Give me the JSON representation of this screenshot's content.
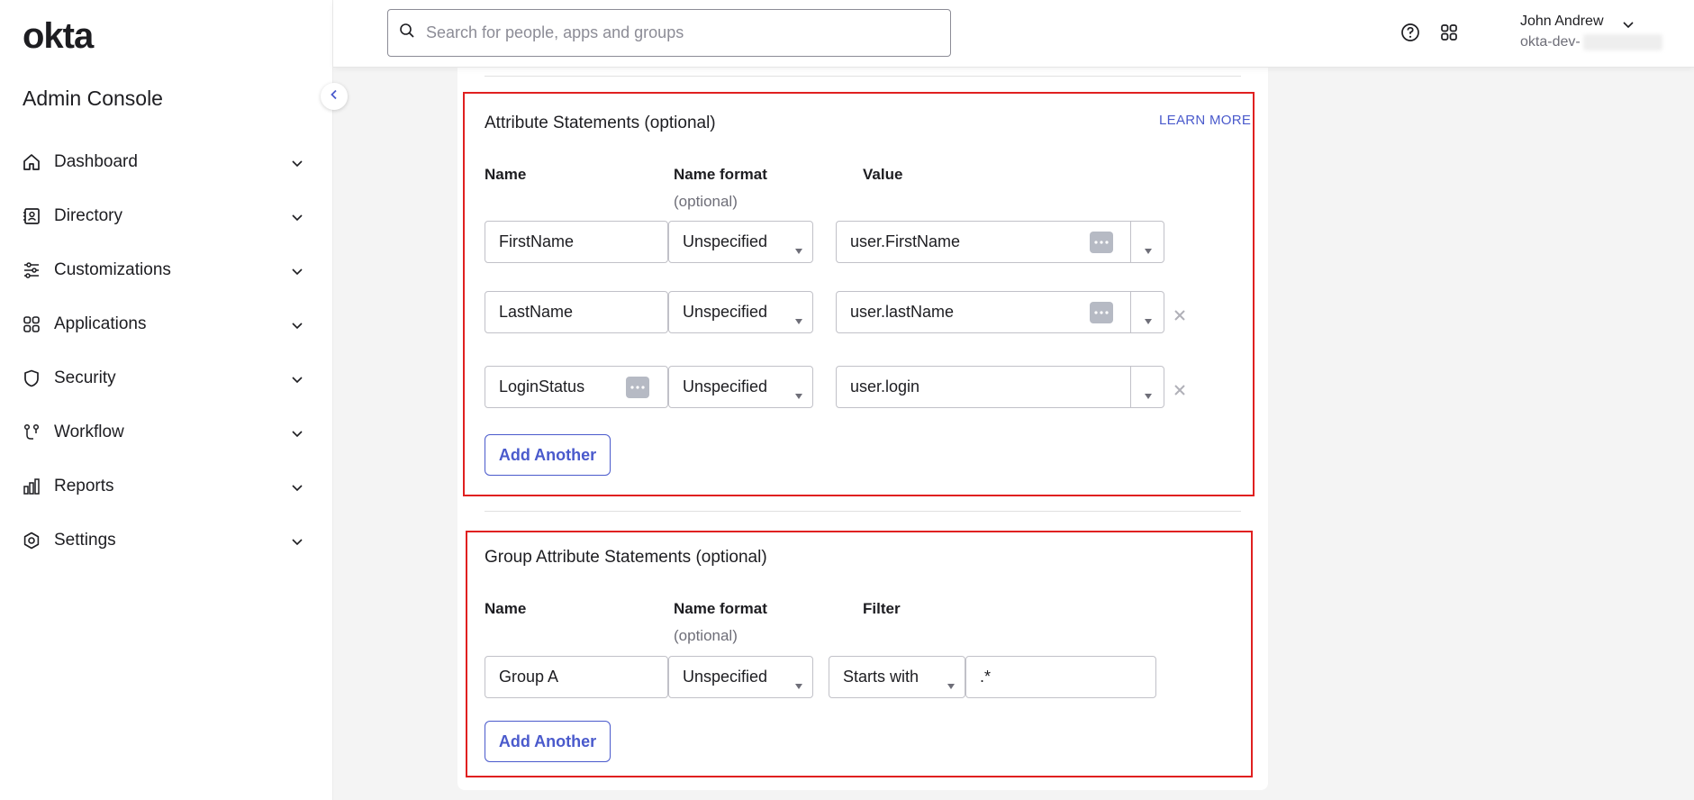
{
  "sidebar": {
    "logo": "okta",
    "console_title": "Admin Console",
    "items": [
      {
        "label": "Dashboard",
        "icon": "home-icon"
      },
      {
        "label": "Directory",
        "icon": "directory-icon"
      },
      {
        "label": "Customizations",
        "icon": "sliders-icon"
      },
      {
        "label": "Applications",
        "icon": "grid-icon"
      },
      {
        "label": "Security",
        "icon": "shield-icon"
      },
      {
        "label": "Workflow",
        "icon": "workflow-icon"
      },
      {
        "label": "Reports",
        "icon": "bar-chart-icon"
      },
      {
        "label": "Settings",
        "icon": "gear-icon"
      }
    ]
  },
  "header": {
    "search_placeholder": "Search for people, apps and groups",
    "user_name": "John Andrew",
    "user_org": "okta-dev-"
  },
  "attributes": {
    "title": "Attribute Statements (optional)",
    "learn_more": "LEARN MORE",
    "col_name": "Name",
    "col_format": "Name format",
    "col_format_sub": "(optional)",
    "col_value": "Value",
    "rows": [
      {
        "name": "FirstName",
        "format": "Unspecified",
        "value": "user.FirstName"
      },
      {
        "name": "LastName",
        "format": "Unspecified",
        "value": "user.lastName"
      },
      {
        "name": "LoginStatus",
        "format": "Unspecified",
        "value": "user.login"
      }
    ],
    "add_button": "Add Another"
  },
  "group_attributes": {
    "title": "Group Attribute Statements (optional)",
    "col_name": "Name",
    "col_format": "Name format",
    "col_format_sub": "(optional)",
    "col_filter": "Filter",
    "rows": [
      {
        "name": "Group A",
        "format": "Unspecified",
        "filter_type": "Starts with",
        "filter_value": ".*"
      }
    ],
    "add_button": "Add Another"
  },
  "colors": {
    "accent": "#4a5acc",
    "highlight_border": "#e02020",
    "ellipsis_button": "#b6bac4"
  }
}
